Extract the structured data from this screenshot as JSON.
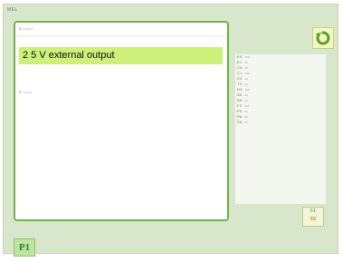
{
  "header": {
    "label": "MEL"
  },
  "list": {
    "row1": "€ ••••••",
    "selected": "2  5 V external output",
    "row3": "€ •••••"
  },
  "params": [
    {
      "code": "E0",
      "text": "•••"
    },
    {
      "code": "E1",
      "text": "••"
    },
    {
      "code": "C0",
      "text": "••"
    },
    {
      "code": "C1",
      "text": "•••"
    },
    {
      "code": "C2",
      "text": "••"
    },
    {
      "code": "T0",
      "text": "••"
    },
    {
      "code": "D0",
      "text": "•••"
    },
    {
      "code": "A0",
      "text": "••"
    },
    {
      "code": "B0",
      "text": "••"
    },
    {
      "code": "F0",
      "text": "•••"
    },
    {
      "code": "P0",
      "text": "••"
    },
    {
      "code": "Ph",
      "text": "••"
    },
    {
      "code": "Sh",
      "text": "••"
    }
  ],
  "page_button": {
    "top": "F1",
    "bottom": "F2"
  },
  "badge": {
    "label": "P1"
  },
  "icons": {
    "refresh": "refresh-icon"
  },
  "colors": {
    "background": "#d8e7cc",
    "panel_border": "#6eb14a",
    "selection": "#cdf07a",
    "refresh_arrow": "#5aa227"
  }
}
